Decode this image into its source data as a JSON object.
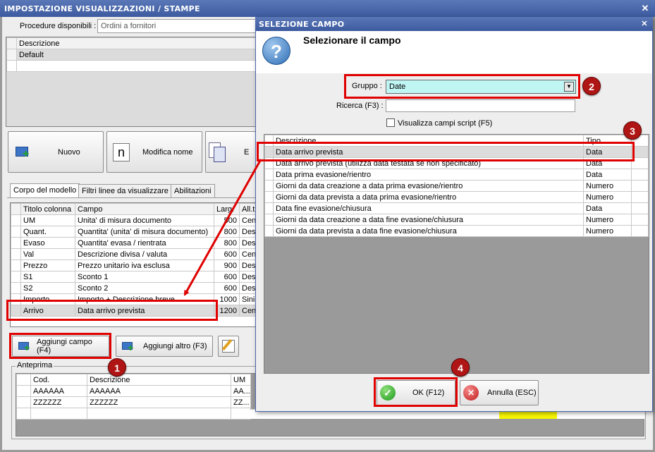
{
  "main_window": {
    "title": "IMPOSTAZIONE VISUALIZZAZIONI / STAMPE",
    "procedure_label": "Procedure disponibili :",
    "procedure_value": "Ordini a fornitori",
    "models_header": "Descrizione",
    "models": [
      "Default"
    ],
    "buttons": {
      "nuovo": "Nuovo",
      "modifica_nome": "Modifica nome",
      "partial": "E"
    },
    "tabs": [
      "Corpo del modello",
      "Filtri linee da visualizzare",
      "Abilitazioni"
    ],
    "columns_headers": [
      "Titolo colonna",
      "Campo",
      "Larg.",
      "All.t"
    ],
    "columns_rows": [
      [
        "UM",
        "Unita' di misura documento",
        "500",
        "Cen"
      ],
      [
        "Quant.",
        "Quantita' (unita' di misura documento)",
        "800",
        "Des"
      ],
      [
        "Evaso",
        "Quantita' evasa / rientrata",
        "800",
        "Des"
      ],
      [
        "Val",
        "Descrizione divisa / valuta",
        "600",
        "Cen"
      ],
      [
        "Prezzo",
        "Prezzo unitario iva esclusa",
        "900",
        "Des"
      ],
      [
        "S1",
        "Sconto 1",
        "600",
        "Des"
      ],
      [
        "S2",
        "Sconto 2",
        "600",
        "Des"
      ],
      [
        "Importo",
        "Importo + Descrizione breve",
        "1000",
        "Sinis"
      ],
      [
        "Arrivo",
        "Data arrivo prevista",
        "1200",
        "Cen"
      ]
    ],
    "aggiungi_campo": "Aggiungi campo (F4)",
    "aggiungi_altro": "Aggiungi altro (F3)",
    "anteprima_label": "Anteprima",
    "preview_headers": [
      "Cod.",
      "Descrizione",
      "UM"
    ],
    "preview_rows": [
      [
        "AAAAAA",
        "AAAAAA",
        "AA..."
      ],
      [
        "ZZZZZZ",
        "ZZZZZZ",
        "ZZ..."
      ]
    ]
  },
  "dialog": {
    "title": "SELEZIONE CAMPO",
    "heading": "Selezionare il campo",
    "gruppo_label": "Gruppo :",
    "gruppo_value": "Date",
    "ricerca_label": "Ricerca (F3) :",
    "ricerca_value": "",
    "script_checkbox": "Visualizza campi script (F5)",
    "headers": [
      "Descrizione",
      "Tipo"
    ],
    "rows": [
      [
        "Data arrivo prevista",
        "Data"
      ],
      [
        "Data arrivo prevista (utilizza data testata se non specificato)",
        "Data"
      ],
      [
        "Data prima evasione/rientro",
        "Data"
      ],
      [
        "Giorni da data creazione a data prima evasione/rientro",
        "Numero"
      ],
      [
        "Giorni da data prevista a data prima evasione/rientro",
        "Numero"
      ],
      [
        "Data fine evasione/chiusura",
        "Data"
      ],
      [
        "Giorni da data creazione a data fine evasione/chiusura",
        "Numero"
      ],
      [
        "Giorni da data prevista a data fine evasione/chiusura",
        "Numero"
      ]
    ],
    "ok": "OK (F12)",
    "annulla": "Annulla (ESC)"
  },
  "badges": [
    "1",
    "2",
    "3",
    "4"
  ],
  "colors": {
    "highlight_red": "#e00000",
    "badge": "#b01515",
    "gruppo_bg": "#bff5f3",
    "titlebar": "#4a68ac"
  }
}
